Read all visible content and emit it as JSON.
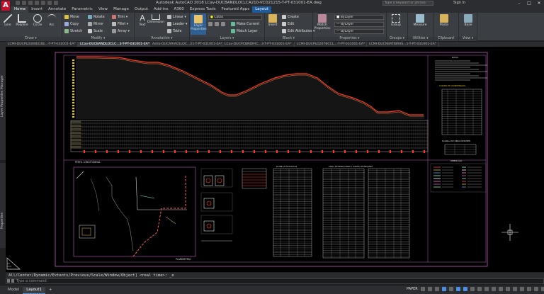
{
  "title_bar": {
    "app_logo": "A",
    "title": "Autodesk AutoCAD 2018    LCav-DUCBANDLOCLCA210-VCD21215-T-PT-031001-EA.dwg",
    "search_placeholder": "Type a keyword or phrase",
    "sign_in": "Sign In"
  },
  "ribbon_tabs": [
    "Home",
    "Insert",
    "Annotate",
    "Parametric",
    "View",
    "Manage",
    "Output",
    "Add-ins",
    "A360",
    "Express Tools",
    "Featured Apps",
    "Layout"
  ],
  "ribbon_active": "Home",
  "ribbon": {
    "draw": {
      "title": "Draw ▾",
      "line": "Line",
      "polyline": "Polyline",
      "circle": "Circle",
      "arc": "Arc"
    },
    "modify": {
      "title": "Modify ▾",
      "move": "Move",
      "rotate": "Rotate",
      "trim": "Trim ▾",
      "copy": "Copy",
      "mirror": "Mirror",
      "fillet": "Fillet ▾",
      "stretch": "Stretch",
      "scale": "Scale",
      "array": "Array ▾"
    },
    "annotation": {
      "title": "Annotation ▾",
      "text": "Text",
      "dimension": "Dimension",
      "linear": "Linear ▾",
      "leader": "Leader ▾",
      "table": "Table"
    },
    "layers": {
      "title": "Layers ▾",
      "layer_properties": "Layer Properties",
      "current_layer": "Cotas",
      "make_current": "Make Current",
      "match_layer": "Match Layer"
    },
    "block": {
      "title": "Block ▾",
      "insert": "Insert",
      "create": "Create",
      "edit": "Edit",
      "edit_attributes": "Edit Attributes ▾"
    },
    "properties": {
      "title": "Properties ▾",
      "match_properties": "Match Properties",
      "color": "ByLayer",
      "linetype": "ByLayer",
      "lineweight": "ByLayer"
    },
    "groups": {
      "title": "Groups ▾",
      "group": "Group"
    },
    "utilities": {
      "title": "Utilities ▾",
      "measure": "Measure"
    },
    "clipboard": {
      "title": "Clipboard",
      "paste": "Paste"
    },
    "view": {
      "title": "View ▾",
      "base": "Base"
    }
  },
  "doc_tabs": [
    "LCMI-DUCPL0300EC48...-T-PT-031001-EA*",
    "LCav-DUCBANDLOCLC...3-T-PT-031001-EA*",
    "Ashb-DUCARIA01LOC...21-T-PT-031001-EA*",
    "LCav-DUCPCBNDIFIC...3-T-PT-031001-EA*",
    "LCMI-DUCPLO2078CCL...-T-PT-031001-EA*",
    "LCMI-DUCRBATIBRIIS...1-T-PT-031001-EA*"
  ],
  "doc_active_index": 1,
  "side_palettes": {
    "layer_manager": "Layer Properties Manager",
    "properties": "Properties"
  },
  "drawing": {
    "profile_label": "PERFIL LONGITUDINAL",
    "plan_label": "PLANIMETRIA",
    "notes_title": "NOTAS",
    "coords_title": "CUADRO DE COORDENADAS",
    "table1_title": "PLANILLA DE ESTACAS",
    "table2_title": "TABLA DE BENCH MARK Y PUNTOS DE RELLENO",
    "legend_title": "SIMBOLOGIA",
    "bottom_table_title": "PLANILLA DE OBRAS RESUMEN"
  },
  "command": {
    "history": "All/Center/Dynamic/Extents/Previous/Scale/Window/Object] <real time>: _e",
    "input_placeholder": "Type a command"
  },
  "status": {
    "layouts": [
      "Model",
      "Layout1",
      "+"
    ],
    "active_layout": "Layout1",
    "paper": "PAPER"
  },
  "colors": {
    "accent": "#4a90e2",
    "profile_red": "#ff3b1f",
    "brand_red": "#c8102e"
  }
}
